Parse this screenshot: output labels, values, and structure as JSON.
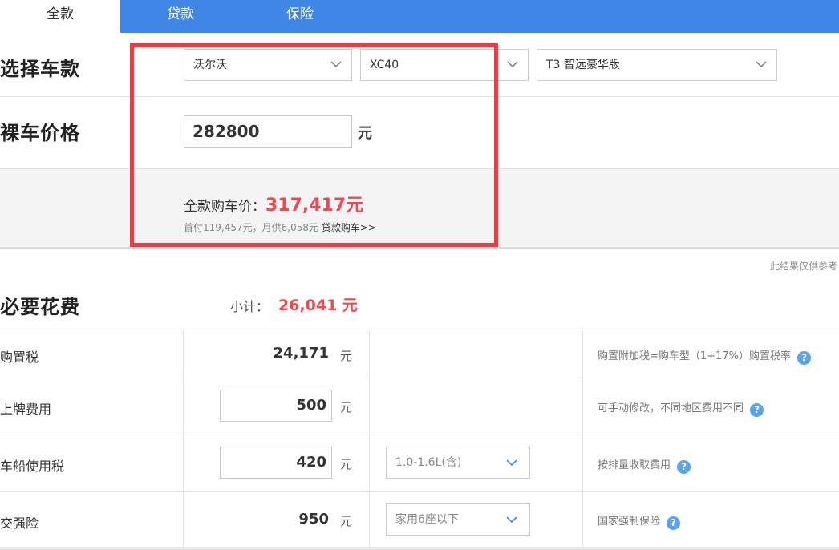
{
  "tabs": [
    {
      "label": "全款"
    },
    {
      "label": "贷款"
    },
    {
      "label": "保险"
    }
  ],
  "select_model": {
    "title": "选择车款",
    "brand": "沃尔沃",
    "series": "XC40",
    "trim": "T3 智远豪华版"
  },
  "bare_price": {
    "title": "裸车价格",
    "value": "282800",
    "unit": "元"
  },
  "total": {
    "label": "全款购车价：",
    "value": "317,417元",
    "sub": "首付119,457元，月供6,058元",
    "loan_link": "贷款购车>>"
  },
  "disclaimer": "此结果仅供参考",
  "required_fees": {
    "title": "必要花费",
    "subtotal_label": "小计：",
    "subtotal_value": "26,041 元",
    "rows": [
      {
        "label": "购置税",
        "value": "24,171",
        "unit": "元",
        "option": "",
        "note": "购置附加税=购车型（1+17%）购置税率"
      },
      {
        "label": "上牌费用",
        "value": "500",
        "unit": "元",
        "option": "",
        "note": "可手动修改，不同地区费用不同"
      },
      {
        "label": "车船使用税",
        "value": "420",
        "unit": "元",
        "option": "1.0-1.6L(含)",
        "note": "按排量收取费用"
      },
      {
        "label": "交强险",
        "value": "950",
        "unit": "元",
        "option": "家用6座以下",
        "note": "国家强制保险"
      }
    ]
  },
  "icons": {
    "help": "question-circle-icon",
    "dropdown": "chevron-down-icon"
  },
  "colors": {
    "tab_bar": "#3f86e6",
    "accent_red": "#f0484f",
    "highlight_box": "#f03a3f",
    "help_icon": "#5aa3f0"
  }
}
